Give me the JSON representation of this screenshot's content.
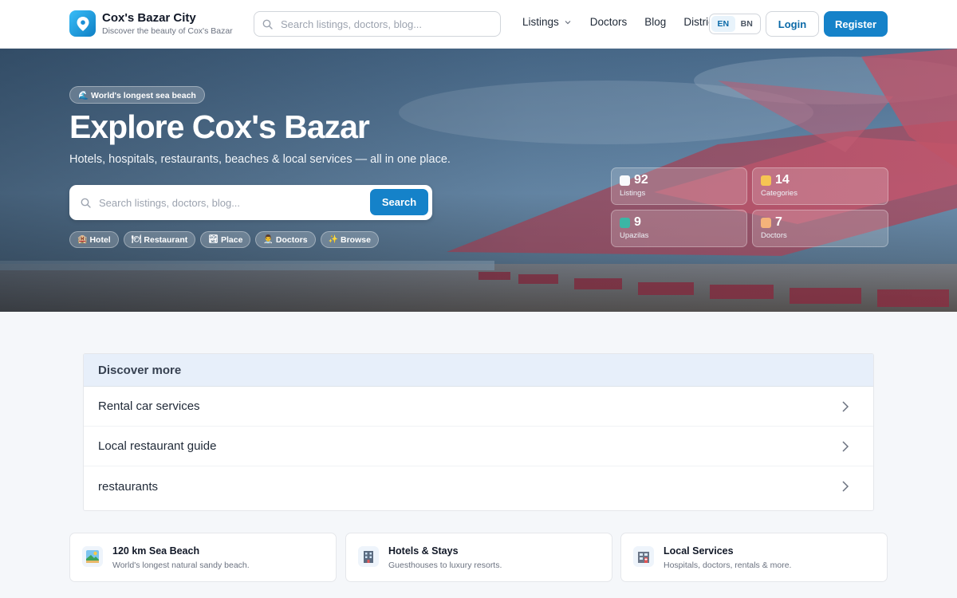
{
  "header": {
    "brand_name": "Cox's Bazar City",
    "brand_tagline": "Discover the beauty of Cox's Bazar",
    "search_placeholder": "Search listings, doctors, blog...",
    "nav": [
      {
        "label": "Listings",
        "has_dropdown": true
      },
      {
        "label": "Doctors"
      },
      {
        "label": "Blog"
      },
      {
        "label": "District"
      }
    ],
    "languages": [
      "EN",
      "BN"
    ],
    "active_language": "EN",
    "login_label": "Login",
    "register_label": "Register"
  },
  "hero": {
    "badge": "🌊 World's longest sea beach",
    "title": "Explore Cox's Bazar",
    "subtitle": "Hotels, hospitals, restaurants, beaches & local services — all in one place.",
    "search_placeholder": "Search listings, doctors, blog...",
    "search_button": "Search",
    "chips": [
      {
        "icon": "🏨",
        "label": "Hotel"
      },
      {
        "icon": "🍽",
        "label": "Restaurant"
      },
      {
        "icon": "🏞",
        "label": "Place"
      },
      {
        "icon": "👨‍⚕️",
        "label": "Doctors"
      },
      {
        "icon": "✨",
        "label": "Browse"
      }
    ],
    "stats": [
      {
        "value": "92",
        "label": "Listings",
        "icon": "clipboard-icon",
        "color": "#f8fafc"
      },
      {
        "value": "14",
        "label": "Categories",
        "icon": "tag-icon",
        "color": "#f6c453"
      },
      {
        "value": "9",
        "label": "Upazilas",
        "icon": "map-icon",
        "color": "#3bb6a5"
      },
      {
        "value": "7",
        "label": "Doctors",
        "icon": "doctor-icon",
        "color": "#f4b27a"
      }
    ]
  },
  "discover": {
    "title": "Discover more",
    "items": [
      "Rental car services",
      "Local restaurant guide",
      "restaurants"
    ]
  },
  "features": [
    {
      "title": "120 km Sea Beach",
      "desc": "World's longest natural sandy beach.",
      "icon": "beach-icon"
    },
    {
      "title": "Hotels & Stays",
      "desc": "Guesthouses to luxury resorts.",
      "icon": "hotel-icon"
    },
    {
      "title": "Local Services",
      "desc": "Hospitals, doctors, rentals & more.",
      "icon": "services-icon"
    }
  ],
  "colors": {
    "primary": "#1582c9",
    "accent_text": "#0b6aa8"
  }
}
